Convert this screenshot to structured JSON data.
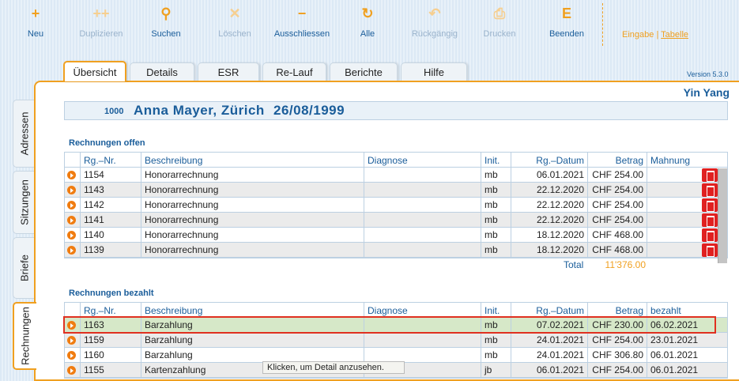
{
  "toolbar": {
    "buttons": [
      {
        "label": "Neu",
        "icon": "+",
        "enabled": true
      },
      {
        "label": "Duplizieren",
        "icon": "++",
        "enabled": false
      },
      {
        "label": "Suchen",
        "icon": "⚲",
        "enabled": true
      },
      {
        "label": "Löschen",
        "icon": "✕",
        "enabled": false
      },
      {
        "label": "Ausschliessen",
        "icon": "−",
        "enabled": true
      },
      {
        "label": "Alle",
        "icon": "↻",
        "enabled": true
      },
      {
        "label": "Rückgängig",
        "icon": "↶",
        "enabled": false
      },
      {
        "label": "Drucken",
        "icon": "⎙",
        "enabled": false
      },
      {
        "label": "Beenden",
        "icon": "E",
        "enabled": true
      }
    ],
    "view_toggle": {
      "eingabe": "Eingabe",
      "separator": "|",
      "tabelle": "Tabelle"
    }
  },
  "version": "Version  5.3.0",
  "tabs": [
    "Übersicht",
    "Details",
    "ESR",
    "Re-Lauf",
    "Berichte",
    "Hilfe"
  ],
  "active_tab": "Übersicht",
  "side_tabs": [
    "Adressen",
    "Sitzungen",
    "Briefe",
    "Rechnungen"
  ],
  "active_side_tab": "Rechnungen",
  "clinic": "Yin Yang",
  "patient": {
    "id": "1000",
    "name": "Anna Mayer, Zürich",
    "date": "26/08/1999"
  },
  "open_invoices": {
    "title": "Rechnungen offen",
    "headers": [
      "Rg.–Nr.",
      "Beschreibung",
      "Diagnose",
      "Init.",
      "Rg.–Datum",
      "Betrag",
      "Mahnung"
    ],
    "rows": [
      {
        "nr": "1154",
        "desc": "Honorarrechnung",
        "diag": "",
        "init": "mb",
        "date": "06.01.2021",
        "amount": "CHF 254.00",
        "extra": ""
      },
      {
        "nr": "1143",
        "desc": "Honorarrechnung",
        "diag": "",
        "init": "mb",
        "date": "22.12.2020",
        "amount": "CHF 254.00",
        "extra": ""
      },
      {
        "nr": "1142",
        "desc": "Honorarrechnung",
        "diag": "",
        "init": "mb",
        "date": "22.12.2020",
        "amount": "CHF 254.00",
        "extra": ""
      },
      {
        "nr": "1141",
        "desc": "Honorarrechnung",
        "diag": "",
        "init": "mb",
        "date": "22.12.2020",
        "amount": "CHF 254.00",
        "extra": ""
      },
      {
        "nr": "1140",
        "desc": "Honorarrechnung",
        "diag": "",
        "init": "mb",
        "date": "18.12.2020",
        "amount": "CHF 468.00",
        "extra": ""
      },
      {
        "nr": "1139",
        "desc": "Honorarrechnung",
        "diag": "",
        "init": "mb",
        "date": "18.12.2020",
        "amount": "CHF 468.00",
        "extra": ""
      }
    ],
    "total_label": "Total",
    "total_value": "11'376.00"
  },
  "paid_invoices": {
    "title": "Rechnungen bezahlt",
    "headers": [
      "Rg.–Nr.",
      "Beschreibung",
      "Diagnose",
      "Init.",
      "Rg.–Datum",
      "Betrag",
      "bezahlt"
    ],
    "rows": [
      {
        "nr": "1163",
        "desc": "Barzahlung",
        "diag": "",
        "init": "mb",
        "date": "07.02.2021",
        "amount": "CHF 230.00",
        "extra": "06.02.2021"
      },
      {
        "nr": "1159",
        "desc": "Barzahlung",
        "diag": "",
        "init": "mb",
        "date": "24.01.2021",
        "amount": "CHF 254.00",
        "extra": "23.01.2021"
      },
      {
        "nr": "1160",
        "desc": "Barzahlung",
        "diag": "",
        "init": "mb",
        "date": "24.01.2021",
        "amount": "CHF 306.80",
        "extra": "06.01.2021"
      },
      {
        "nr": "1155",
        "desc": "Kartenzahlung",
        "diag": "",
        "init": "jb",
        "date": "06.01.2021",
        "amount": "CHF 254.00",
        "extra": "06.01.2021"
      }
    ],
    "selected_index": 0
  },
  "tooltip": "Klicken, um Detail anzusehen.",
  "colors": {
    "accent": "#f0a020",
    "brand": "#1a5d9a",
    "delete": "#e02020",
    "selected_row": "#d6e8c8",
    "highlight_border": "#e03020"
  }
}
